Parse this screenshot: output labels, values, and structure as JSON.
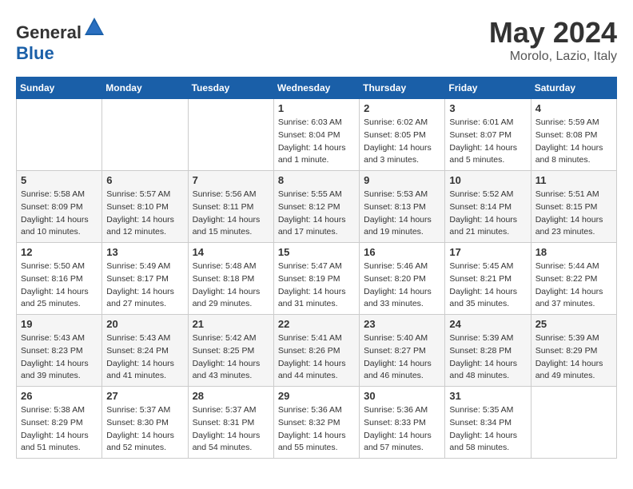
{
  "header": {
    "logo_general": "General",
    "logo_blue": "Blue",
    "month": "May 2024",
    "location": "Morolo, Lazio, Italy"
  },
  "days_of_week": [
    "Sunday",
    "Monday",
    "Tuesday",
    "Wednesday",
    "Thursday",
    "Friday",
    "Saturday"
  ],
  "weeks": [
    [
      {
        "day": "",
        "info": ""
      },
      {
        "day": "",
        "info": ""
      },
      {
        "day": "",
        "info": ""
      },
      {
        "day": "1",
        "info": "Sunrise: 6:03 AM\nSunset: 8:04 PM\nDaylight: 14 hours\nand 1 minute."
      },
      {
        "day": "2",
        "info": "Sunrise: 6:02 AM\nSunset: 8:05 PM\nDaylight: 14 hours\nand 3 minutes."
      },
      {
        "day": "3",
        "info": "Sunrise: 6:01 AM\nSunset: 8:07 PM\nDaylight: 14 hours\nand 5 minutes."
      },
      {
        "day": "4",
        "info": "Sunrise: 5:59 AM\nSunset: 8:08 PM\nDaylight: 14 hours\nand 8 minutes."
      }
    ],
    [
      {
        "day": "5",
        "info": "Sunrise: 5:58 AM\nSunset: 8:09 PM\nDaylight: 14 hours\nand 10 minutes."
      },
      {
        "day": "6",
        "info": "Sunrise: 5:57 AM\nSunset: 8:10 PM\nDaylight: 14 hours\nand 12 minutes."
      },
      {
        "day": "7",
        "info": "Sunrise: 5:56 AM\nSunset: 8:11 PM\nDaylight: 14 hours\nand 15 minutes."
      },
      {
        "day": "8",
        "info": "Sunrise: 5:55 AM\nSunset: 8:12 PM\nDaylight: 14 hours\nand 17 minutes."
      },
      {
        "day": "9",
        "info": "Sunrise: 5:53 AM\nSunset: 8:13 PM\nDaylight: 14 hours\nand 19 minutes."
      },
      {
        "day": "10",
        "info": "Sunrise: 5:52 AM\nSunset: 8:14 PM\nDaylight: 14 hours\nand 21 minutes."
      },
      {
        "day": "11",
        "info": "Sunrise: 5:51 AM\nSunset: 8:15 PM\nDaylight: 14 hours\nand 23 minutes."
      }
    ],
    [
      {
        "day": "12",
        "info": "Sunrise: 5:50 AM\nSunset: 8:16 PM\nDaylight: 14 hours\nand 25 minutes."
      },
      {
        "day": "13",
        "info": "Sunrise: 5:49 AM\nSunset: 8:17 PM\nDaylight: 14 hours\nand 27 minutes."
      },
      {
        "day": "14",
        "info": "Sunrise: 5:48 AM\nSunset: 8:18 PM\nDaylight: 14 hours\nand 29 minutes."
      },
      {
        "day": "15",
        "info": "Sunrise: 5:47 AM\nSunset: 8:19 PM\nDaylight: 14 hours\nand 31 minutes."
      },
      {
        "day": "16",
        "info": "Sunrise: 5:46 AM\nSunset: 8:20 PM\nDaylight: 14 hours\nand 33 minutes."
      },
      {
        "day": "17",
        "info": "Sunrise: 5:45 AM\nSunset: 8:21 PM\nDaylight: 14 hours\nand 35 minutes."
      },
      {
        "day": "18",
        "info": "Sunrise: 5:44 AM\nSunset: 8:22 PM\nDaylight: 14 hours\nand 37 minutes."
      }
    ],
    [
      {
        "day": "19",
        "info": "Sunrise: 5:43 AM\nSunset: 8:23 PM\nDaylight: 14 hours\nand 39 minutes."
      },
      {
        "day": "20",
        "info": "Sunrise: 5:43 AM\nSunset: 8:24 PM\nDaylight: 14 hours\nand 41 minutes."
      },
      {
        "day": "21",
        "info": "Sunrise: 5:42 AM\nSunset: 8:25 PM\nDaylight: 14 hours\nand 43 minutes."
      },
      {
        "day": "22",
        "info": "Sunrise: 5:41 AM\nSunset: 8:26 PM\nDaylight: 14 hours\nand 44 minutes."
      },
      {
        "day": "23",
        "info": "Sunrise: 5:40 AM\nSunset: 8:27 PM\nDaylight: 14 hours\nand 46 minutes."
      },
      {
        "day": "24",
        "info": "Sunrise: 5:39 AM\nSunset: 8:28 PM\nDaylight: 14 hours\nand 48 minutes."
      },
      {
        "day": "25",
        "info": "Sunrise: 5:39 AM\nSunset: 8:29 PM\nDaylight: 14 hours\nand 49 minutes."
      }
    ],
    [
      {
        "day": "26",
        "info": "Sunrise: 5:38 AM\nSunset: 8:29 PM\nDaylight: 14 hours\nand 51 minutes."
      },
      {
        "day": "27",
        "info": "Sunrise: 5:37 AM\nSunset: 8:30 PM\nDaylight: 14 hours\nand 52 minutes."
      },
      {
        "day": "28",
        "info": "Sunrise: 5:37 AM\nSunset: 8:31 PM\nDaylight: 14 hours\nand 54 minutes."
      },
      {
        "day": "29",
        "info": "Sunrise: 5:36 AM\nSunset: 8:32 PM\nDaylight: 14 hours\nand 55 minutes."
      },
      {
        "day": "30",
        "info": "Sunrise: 5:36 AM\nSunset: 8:33 PM\nDaylight: 14 hours\nand 57 minutes."
      },
      {
        "day": "31",
        "info": "Sunrise: 5:35 AM\nSunset: 8:34 PM\nDaylight: 14 hours\nand 58 minutes."
      },
      {
        "day": "",
        "info": ""
      }
    ]
  ]
}
